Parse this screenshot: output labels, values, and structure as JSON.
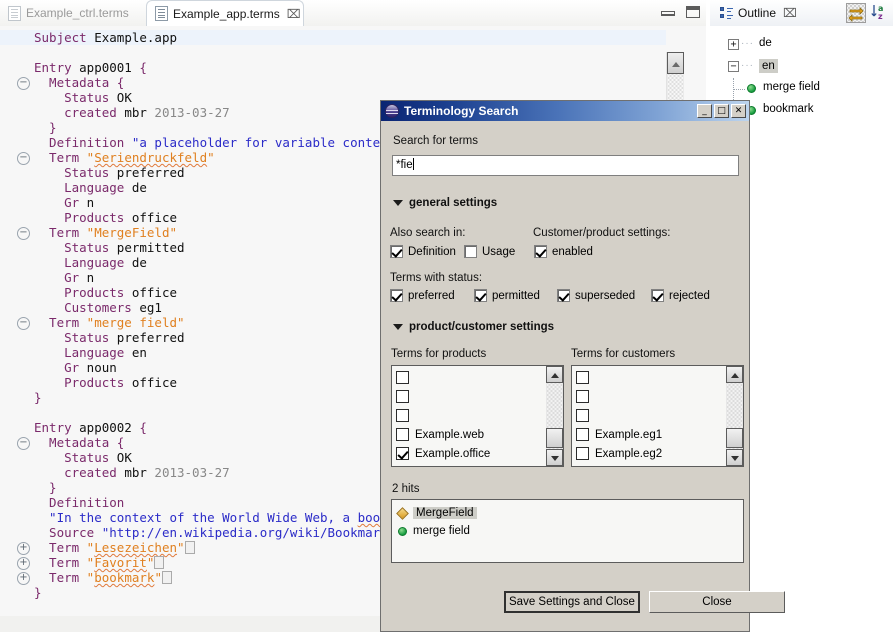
{
  "editor": {
    "tabs": [
      {
        "label": "Example_ctrl.terms",
        "active": false,
        "closable": false
      },
      {
        "label": "Example_app.terms",
        "active": true,
        "closable": true,
        "close_glyph": "⌧"
      }
    ],
    "minimize_tooltip": "Minimize",
    "maximize_tooltip": "Maximize",
    "lines": [
      {
        "indent": 0,
        "fold": "",
        "highlight": true,
        "parts": [
          {
            "t": "Subject ",
            "c": "kw"
          },
          {
            "t": "Example.app",
            "c": "plain"
          }
        ]
      },
      {
        "indent": 0,
        "fold": "",
        "parts": []
      },
      {
        "indent": 0,
        "fold": "",
        "parts": [
          {
            "t": "Entry ",
            "c": "kw"
          },
          {
            "t": "app0001",
            "c": "plain"
          },
          {
            "t": " {",
            "c": "brace"
          }
        ]
      },
      {
        "indent": 1,
        "fold": "minus",
        "parts": [
          {
            "t": "  Metadata",
            "c": "kw"
          },
          {
            "t": " {",
            "c": "brace"
          }
        ]
      },
      {
        "indent": 2,
        "fold": "",
        "parts": [
          {
            "t": "    Status",
            "c": "kw"
          },
          {
            "t": " OK",
            "c": "plain"
          }
        ]
      },
      {
        "indent": 2,
        "fold": "",
        "parts": [
          {
            "t": "    created",
            "c": "kw"
          },
          {
            "t": " mbr",
            "c": "plain"
          },
          {
            "t": " 2013-03-27",
            "c": "gray"
          }
        ]
      },
      {
        "indent": 1,
        "fold": "",
        "parts": [
          {
            "t": "  }",
            "c": "brace"
          }
        ]
      },
      {
        "indent": 1,
        "fold": "",
        "parts": [
          {
            "t": "  Definition",
            "c": "kw"
          },
          {
            "t": " \"a placeholder for variable content",
            "c": "str"
          }
        ]
      },
      {
        "indent": 1,
        "fold": "minus",
        "parts": [
          {
            "t": "  Term",
            "c": "kw"
          },
          {
            "t": " \"",
            "c": "strq"
          },
          {
            "t": "Seriendruckfeld",
            "c": "strq squig"
          },
          {
            "t": "\"",
            "c": "strq"
          }
        ]
      },
      {
        "indent": 2,
        "fold": "",
        "parts": [
          {
            "t": "    Status",
            "c": "kw"
          },
          {
            "t": " preferred",
            "c": "plain"
          }
        ]
      },
      {
        "indent": 2,
        "fold": "",
        "parts": [
          {
            "t": "    Language",
            "c": "kw"
          },
          {
            "t": " de",
            "c": "plain"
          }
        ]
      },
      {
        "indent": 2,
        "fold": "",
        "parts": [
          {
            "t": "    Gr",
            "c": "kw"
          },
          {
            "t": " n",
            "c": "plain"
          }
        ]
      },
      {
        "indent": 2,
        "fold": "",
        "parts": [
          {
            "t": "    Products",
            "c": "kw"
          },
          {
            "t": " office",
            "c": "plain"
          }
        ]
      },
      {
        "indent": 1,
        "fold": "minus",
        "parts": [
          {
            "t": "  Term",
            "c": "kw"
          },
          {
            "t": " \"MergeField\"",
            "c": "strq"
          }
        ]
      },
      {
        "indent": 2,
        "fold": "",
        "parts": [
          {
            "t": "    Status",
            "c": "kw"
          },
          {
            "t": " permitted",
            "c": "plain"
          }
        ]
      },
      {
        "indent": 2,
        "fold": "",
        "parts": [
          {
            "t": "    Language",
            "c": "kw"
          },
          {
            "t": " de",
            "c": "plain"
          }
        ]
      },
      {
        "indent": 2,
        "fold": "",
        "parts": [
          {
            "t": "    Gr",
            "c": "kw"
          },
          {
            "t": " n",
            "c": "plain"
          }
        ]
      },
      {
        "indent": 2,
        "fold": "",
        "parts": [
          {
            "t": "    Products",
            "c": "kw"
          },
          {
            "t": " office",
            "c": "plain"
          }
        ]
      },
      {
        "indent": 2,
        "fold": "",
        "parts": [
          {
            "t": "    Customers",
            "c": "kw"
          },
          {
            "t": " eg1",
            "c": "plain"
          }
        ]
      },
      {
        "indent": 1,
        "fold": "minus",
        "parts": [
          {
            "t": "  Term",
            "c": "kw"
          },
          {
            "t": " \"merge field\"",
            "c": "strq"
          }
        ]
      },
      {
        "indent": 2,
        "fold": "",
        "parts": [
          {
            "t": "    Status",
            "c": "kw"
          },
          {
            "t": " preferred",
            "c": "plain"
          }
        ]
      },
      {
        "indent": 2,
        "fold": "",
        "parts": [
          {
            "t": "    Language",
            "c": "kw"
          },
          {
            "t": " en",
            "c": "plain"
          }
        ]
      },
      {
        "indent": 2,
        "fold": "",
        "parts": [
          {
            "t": "    Gr",
            "c": "kw"
          },
          {
            "t": " noun",
            "c": "plain"
          }
        ]
      },
      {
        "indent": 2,
        "fold": "",
        "parts": [
          {
            "t": "    Products",
            "c": "kw"
          },
          {
            "t": " office",
            "c": "plain"
          }
        ]
      },
      {
        "indent": 0,
        "fold": "",
        "parts": [
          {
            "t": "}",
            "c": "brace"
          }
        ]
      },
      {
        "indent": 0,
        "fold": "",
        "parts": []
      },
      {
        "indent": 0,
        "fold": "",
        "parts": [
          {
            "t": "Entry ",
            "c": "kw"
          },
          {
            "t": "app0002",
            "c": "plain"
          },
          {
            "t": " {",
            "c": "brace"
          }
        ]
      },
      {
        "indent": 1,
        "fold": "minus",
        "parts": [
          {
            "t": "  Metadata",
            "c": "kw"
          },
          {
            "t": " {",
            "c": "brace"
          }
        ]
      },
      {
        "indent": 2,
        "fold": "",
        "parts": [
          {
            "t": "    Status",
            "c": "kw"
          },
          {
            "t": " OK",
            "c": "plain"
          }
        ]
      },
      {
        "indent": 2,
        "fold": "",
        "parts": [
          {
            "t": "    created",
            "c": "kw"
          },
          {
            "t": " mbr",
            "c": "plain"
          },
          {
            "t": " 2013-03-27",
            "c": "gray"
          }
        ]
      },
      {
        "indent": 1,
        "fold": "",
        "parts": [
          {
            "t": "  }",
            "c": "brace"
          }
        ]
      },
      {
        "indent": 1,
        "fold": "",
        "parts": [
          {
            "t": "  Definition",
            "c": "kw"
          }
        ]
      },
      {
        "indent": 1,
        "fold": "",
        "parts": [
          {
            "t": "  \"In the context of the World Wide Web, a ",
            "c": "str"
          },
          {
            "t": "bookma",
            "c": "str squig"
          }
        ]
      },
      {
        "indent": 1,
        "fold": "",
        "parts": [
          {
            "t": "  Source",
            "c": "kw"
          },
          {
            "t": " \"http://en.wikipedia.org/wiki/Bookmark_%",
            "c": "str"
          }
        ]
      },
      {
        "indent": 1,
        "fold": "plus",
        "occ": true,
        "parts": [
          {
            "t": "  Term",
            "c": "kw"
          },
          {
            "t": " \"",
            "c": "strq"
          },
          {
            "t": "Lesezeichen",
            "c": "strq squig"
          },
          {
            "t": "\"",
            "c": "strq"
          }
        ]
      },
      {
        "indent": 1,
        "fold": "plus",
        "occ": true,
        "parts": [
          {
            "t": "  Term",
            "c": "kw"
          },
          {
            "t": " \"",
            "c": "strq"
          },
          {
            "t": "Favorit",
            "c": "strq squig"
          },
          {
            "t": "\"",
            "c": "strq"
          }
        ]
      },
      {
        "indent": 1,
        "fold": "plus",
        "occ": true,
        "parts": [
          {
            "t": "  Term",
            "c": "kw"
          },
          {
            "t": " \"",
            "c": "strq"
          },
          {
            "t": "bookmark",
            "c": "strq squig"
          },
          {
            "t": "\"",
            "c": "strq"
          }
        ]
      },
      {
        "indent": 0,
        "fold": "",
        "parts": [
          {
            "t": "}",
            "c": "brace"
          }
        ]
      }
    ]
  },
  "outline": {
    "tab_label": "Outline",
    "close_glyph": "⌧",
    "toolbar": [
      {
        "name": "link-with-editor-icon",
        "pressed": true
      },
      {
        "name": "sort-az-icon",
        "pressed": false
      }
    ],
    "tree": [
      {
        "label": "de",
        "expander": "+",
        "selected": false,
        "depth": 0
      },
      {
        "label": "en",
        "expander": "−",
        "selected": true,
        "depth": 0
      },
      {
        "label": "merge field",
        "expander": "",
        "selected": false,
        "depth": 1
      },
      {
        "label": "bookmark",
        "expander": "",
        "selected": false,
        "depth": 1
      }
    ]
  },
  "dialog": {
    "title": "Terminology Search",
    "window_buttons": [
      {
        "name": "minimize-button",
        "glyph": "_"
      },
      {
        "name": "maximize-button",
        "glyph": "□"
      },
      {
        "name": "close-button",
        "glyph": "✕"
      }
    ],
    "search_label": "Search for terms",
    "search_value": "*fie",
    "search_placeholder": "",
    "general_settings": {
      "header": "general settings",
      "also_search_in_label": "Also search in:",
      "customer_product_label": "Customer/product settings:",
      "also_search_in": [
        {
          "label": "Definition",
          "checked": true
        },
        {
          "label": "Usage",
          "checked": false
        }
      ],
      "customer_product": [
        {
          "label": "enabled",
          "checked": true
        }
      ],
      "terms_with_status_label": "Terms with status:",
      "terms_with_status": [
        {
          "label": "preferred",
          "checked": true
        },
        {
          "label": "permitted",
          "checked": true
        },
        {
          "label": "superseded",
          "checked": true
        },
        {
          "label": "rejected",
          "checked": true
        }
      ]
    },
    "product_customer_settings": {
      "header": "product/customer settings",
      "products_label": "Terms for products",
      "customers_label": "Terms for customers",
      "products": [
        {
          "label": "",
          "checked": false
        },
        {
          "label": "",
          "checked": false
        },
        {
          "label": "",
          "checked": false
        },
        {
          "label": "Example.web",
          "checked": false
        },
        {
          "label": "Example.office",
          "checked": true
        }
      ],
      "customers": [
        {
          "label": "",
          "checked": false
        },
        {
          "label": "",
          "checked": false
        },
        {
          "label": "",
          "checked": false
        },
        {
          "label": "Example.eg1",
          "checked": false
        },
        {
          "label": "Example.eg2",
          "checked": false
        }
      ]
    },
    "hits_label": "2 hits",
    "results": [
      {
        "label": "MergeField",
        "marker": "diamond",
        "selected": true
      },
      {
        "label": "merge field",
        "marker": "circle",
        "selected": false
      }
    ],
    "buttons": [
      {
        "label": "Save Settings and Close",
        "default": true
      },
      {
        "label": "Close",
        "default": false
      }
    ]
  },
  "colors": {
    "dialog_face": "#d4d0c8",
    "title_start": "#0a2472",
    "title_end": "#bcd4ee",
    "selection": "#cdcdc7",
    "keyword": "#7b2a6b",
    "string": "#2b2bc8",
    "term_string": "#e08020",
    "spell_error": "#e07a3c"
  }
}
